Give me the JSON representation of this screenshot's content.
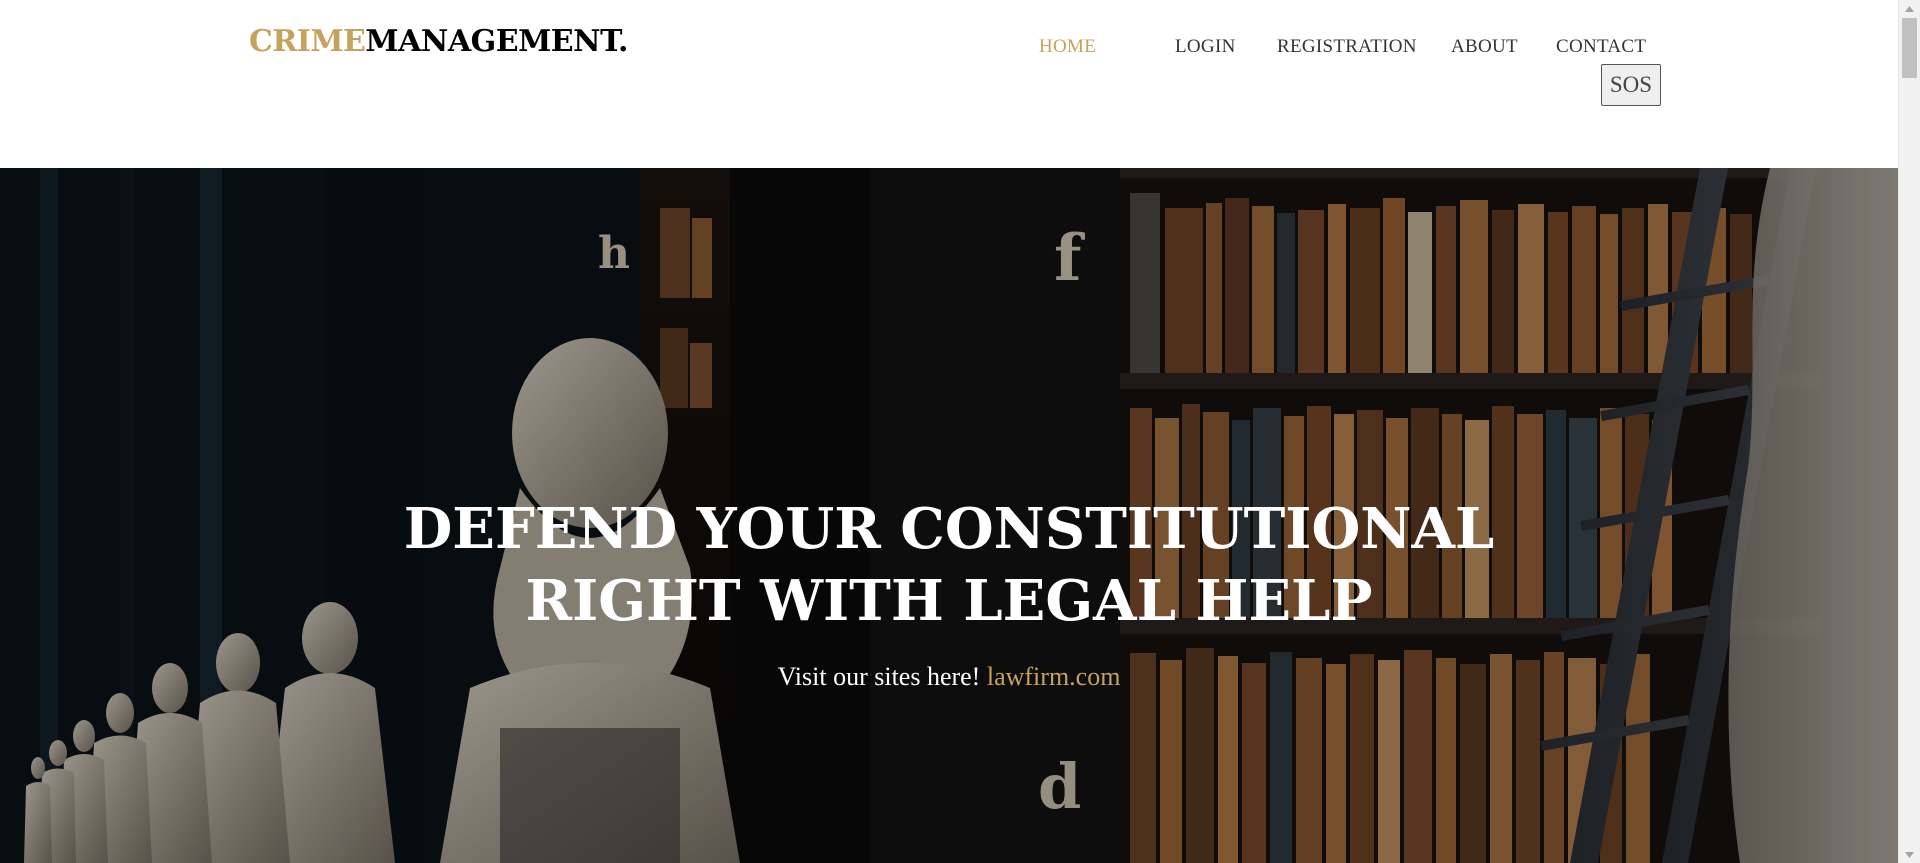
{
  "header": {
    "logo_accent": "CRIME",
    "logo_rest": "MANAGEMENT.",
    "nav": [
      {
        "label": "HOME",
        "active": true
      },
      {
        "label": "LOGIN",
        "active": false
      },
      {
        "label": "REGISTRATION",
        "active": false
      },
      {
        "label": "ABOUT",
        "active": false
      },
      {
        "label": "CONTACT",
        "active": false
      }
    ],
    "sos_label": "SOS"
  },
  "hero": {
    "title_line1": "DEFEND YOUR CONSTITUTIONAL",
    "title_line2": "RIGHT WITH LEGAL HELP",
    "subtitle_prefix": "Visit our sites here!",
    "subtitle_link": "lawfirm.com",
    "background_icon": "library-busts-image"
  },
  "colors": {
    "accent": "#c5a35c",
    "text_dark": "#000000",
    "nav_text": "#333333",
    "hero_text": "#ffffff"
  }
}
